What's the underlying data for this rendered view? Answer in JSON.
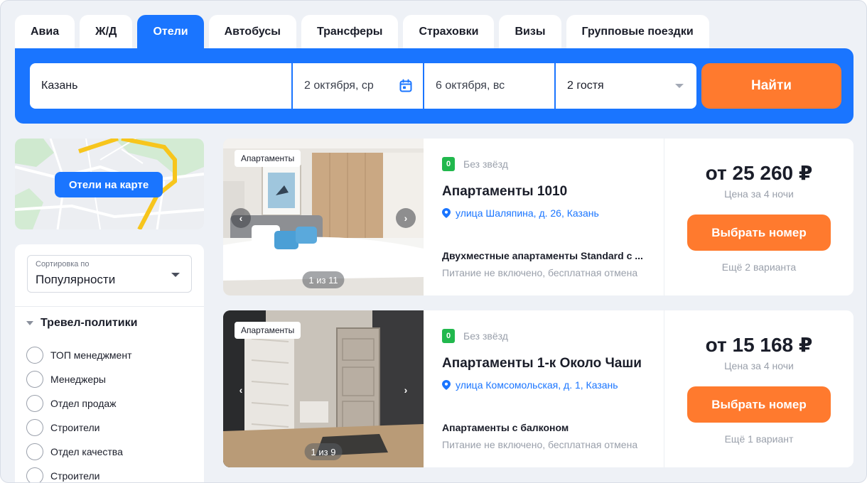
{
  "tabs": [
    "Авиа",
    "Ж/Д",
    "Отели",
    "Автобусы",
    "Трансферы",
    "Страховки",
    "Визы",
    "Групповые поездки"
  ],
  "active_tab": "Отели",
  "search": {
    "destination": "Казань",
    "checkin": "2 октября, ср",
    "checkout": "6 октября, вс",
    "guests": "2 гостя",
    "button": "Найти"
  },
  "map": {
    "button": "Отели на карте"
  },
  "sort": {
    "label": "Сортировка по",
    "value": "Популярности"
  },
  "travel_policies": {
    "title": "Тревел-политики",
    "items": [
      "ТОП менеджмент",
      "Менеджеры",
      "Отдел продаж",
      "Строители",
      "Отдел качества",
      "Строители"
    ]
  },
  "hotels": [
    {
      "tag": "Апартаменты",
      "photo_counter": "1 из 11",
      "star_badge": "0",
      "stars_text": "Без звёзд",
      "name": "Апартаменты 1010",
      "address": "улица Шаляпина, д. 26, Казань",
      "room": "Двухместные апартаменты Standard с ...",
      "meal": "Питание не включено, бесплатная отмена",
      "price": "от 25 260 ₽",
      "nights": "Цена за 4 ночи",
      "choose": "Выбрать номер",
      "more": "Ещё 2 варианта"
    },
    {
      "tag": "Апартаменты",
      "photo_counter": "1 из 9",
      "star_badge": "0",
      "stars_text": "Без звёзд",
      "name": "Апартаменты 1-к Около Чаши",
      "address": "улица Комсомольская, д. 1, Казань",
      "room": "Апартаменты с балконом",
      "meal": "Питание не включено, бесплатная отмена",
      "price": "от 15 168 ₽",
      "nights": "Цена за 4 ночи",
      "choose": "Выбрать номер",
      "more": "Ещё 1 вариант"
    }
  ],
  "colors": {
    "primary": "#1a75ff",
    "accent": "#ff7a2e",
    "star_badge": "#21b84d",
    "background": "#eef1f6"
  },
  "icons": {
    "calendar": "calendar-icon",
    "dropdown": "chevron-down-icon",
    "location": "location-pin-icon",
    "prev": "chevron-left-icon",
    "next": "chevron-right-icon"
  }
}
